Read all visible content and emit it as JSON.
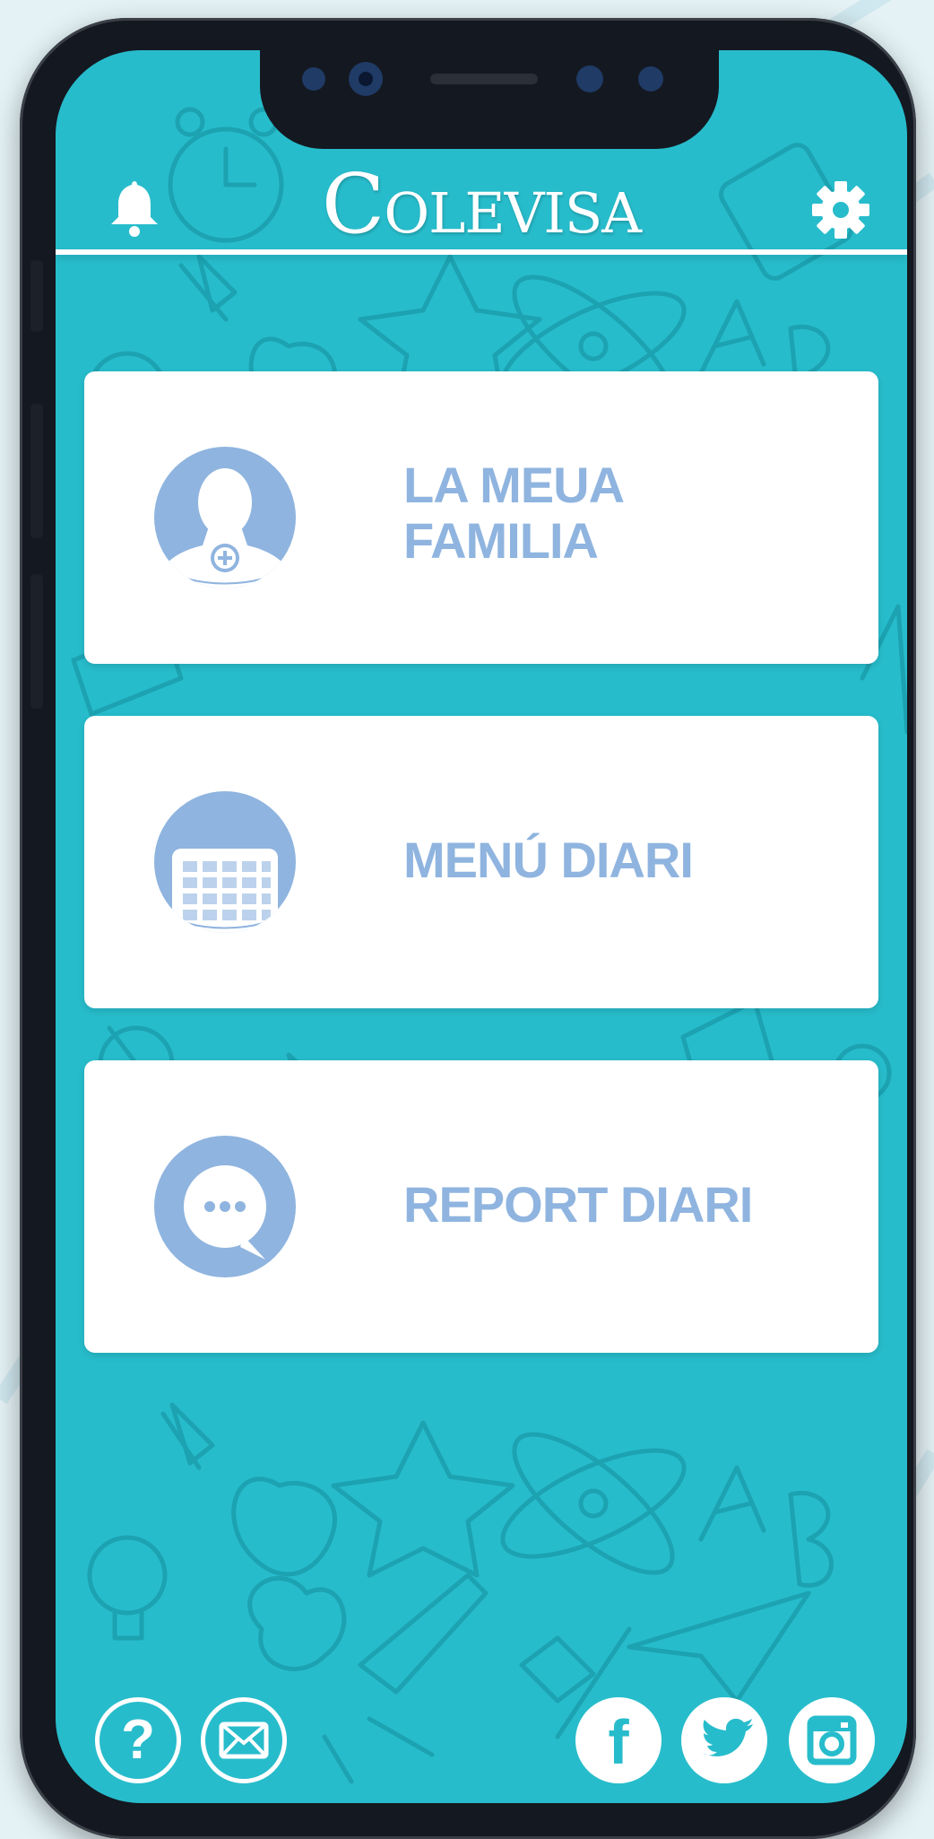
{
  "app": {
    "name": "COLEVISA",
    "logo_initial": "C",
    "logo_rest": "OLEVISA"
  },
  "menu": [
    {
      "label_line1": "LA MEUA",
      "label_line2": "FAMILIA",
      "icon": "add-person-icon"
    },
    {
      "label_line1": "MENÚ DIARI",
      "label_line2": "",
      "icon": "calendar-icon"
    },
    {
      "label_line1": "REPORT DIARI",
      "label_line2": "",
      "icon": "chat-bubble-icon"
    }
  ],
  "header": {
    "left_icon": "bell-icon",
    "right_icon": "gear-icon"
  },
  "footer": {
    "left": [
      {
        "icon": "help-icon",
        "glyph": "?"
      },
      {
        "icon": "mail-icon"
      }
    ],
    "right": [
      {
        "icon": "facebook-icon",
        "glyph": "f"
      },
      {
        "icon": "twitter-icon"
      },
      {
        "icon": "instagram-icon"
      }
    ]
  },
  "colors": {
    "screen_bg": "#27bccb",
    "pattern": "#1b9eae",
    "card_bg": "#ffffff",
    "accent": "#8fb4df",
    "phone_frame": "#141820"
  }
}
